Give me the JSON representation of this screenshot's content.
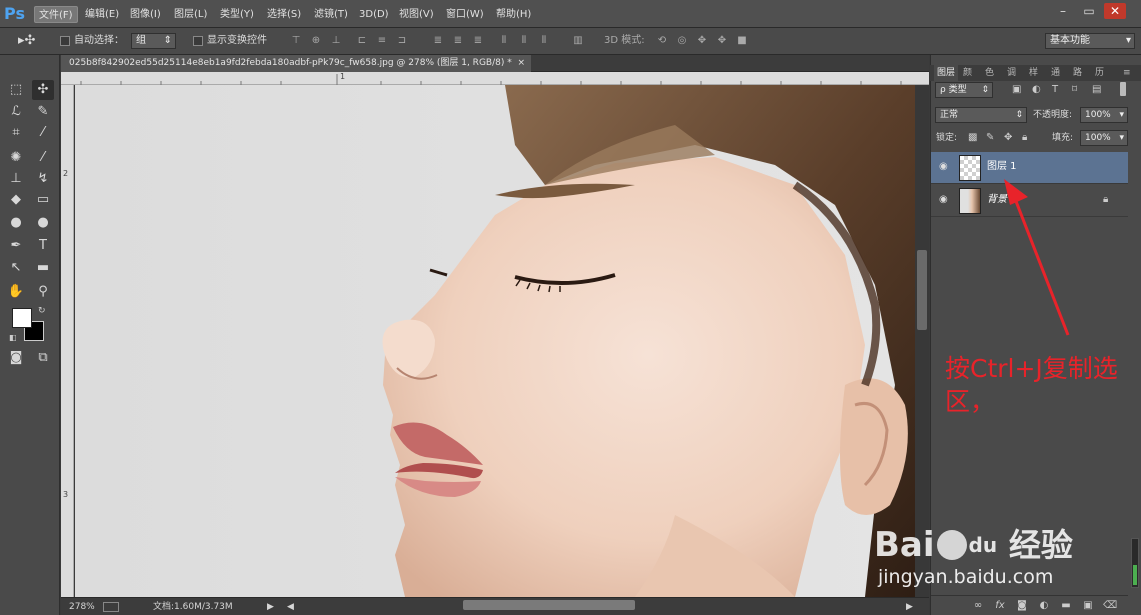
{
  "app": {
    "logo": "Ps"
  },
  "menu": [
    "文件(F)",
    "编辑(E)",
    "图像(I)",
    "图层(L)",
    "类型(Y)",
    "选择(S)",
    "滤镜(T)",
    "3D(D)",
    "视图(V)",
    "窗口(W)",
    "帮助(H)"
  ],
  "window_controls": {
    "minimize": "–",
    "restore": "▭",
    "close": "✕"
  },
  "options": {
    "auto_select_label": "自动选择：",
    "auto_select_value": "组",
    "show_transform_label": "显示变换控件",
    "mode_3d_label": "3D 模式:",
    "workspace": "基本功能"
  },
  "document": {
    "tab_title": "025b8f842902ed55d25114e8eb1a9fd2febda180adbf-pPk79c_fw658.jpg @ 278% (图层 1, RGB/8) *",
    "close": "×",
    "zoom": "278%",
    "doc_info": "文档:1.60M/3.73M",
    "ruler_top": [
      "1"
    ],
    "ruler_left": [
      "2",
      "3"
    ]
  },
  "layers_panel": {
    "tabs": [
      "图层",
      "颜",
      "色",
      "调",
      "样",
      "通",
      "路",
      "历"
    ],
    "filter_kind": "ρ 类型",
    "blend_mode": "正常",
    "opacity_label": "不透明度:",
    "opacity_value": "100%",
    "lock_label": "锁定:",
    "fill_label": "填充:",
    "fill_value": "100%",
    "layers": [
      {
        "name": "图层 1",
        "selected": true,
        "locked": false
      },
      {
        "name": "背景",
        "selected": false,
        "locked": true
      }
    ],
    "bottom_icons": [
      "link-icon",
      "fx-icon",
      "mask-icon",
      "adjust-icon",
      "group-icon",
      "new-layer-icon",
      "trash-icon"
    ]
  },
  "annotation": {
    "line1": "按Ctrl+J复制选",
    "line2": "区，",
    "color": "#e8232a"
  },
  "watermark": {
    "brand": "Bai",
    "brand2": "du",
    "cn": "经验",
    "url": "jingyan.baidu.com"
  },
  "colors": {
    "accent": "#4ea3f0",
    "layer_selected": "#5c7392",
    "annotation": "#e8232a"
  }
}
